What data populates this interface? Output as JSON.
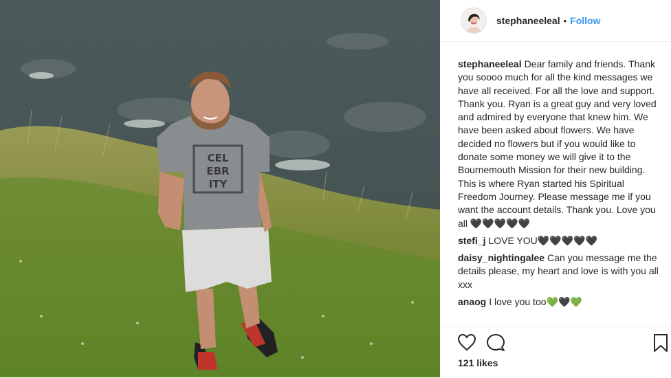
{
  "post": {
    "username": "stephaneeleal",
    "separator": "•",
    "follow_label": "Follow",
    "caption_user": "stephaneeleal",
    "caption_text": "Dear family and friends. Thank you soooo much for all the kind messages we have all received. For all the love and support. Thank you. Ryan is a great guy and very loved and admired by everyone that knew him. We have been asked about flowers. We have decided no flowers but if you would like to donate some money we will give it to the Bournemouth Mission for their new building. This is where Ryan started his Spiritual Freedom Journey. Please message me if you want the account details. Thank you. Love you all 🖤🖤🖤🖤🖤",
    "likes": "121 likes"
  },
  "photo": {
    "shirt_text_1": "CEL",
    "shirt_text_2": "EBR",
    "shirt_text_3": "ITY"
  },
  "comments": [
    {
      "user": "stefi_j",
      "text": "LOVE YOU🖤🖤🖤🖤🖤"
    },
    {
      "user": "daisy_nightingalee",
      "text": "Can you message me the details please, my heart and love is with you all xxx"
    },
    {
      "user": "anaog",
      "text": "I love you too💚🖤💚"
    }
  ],
  "icons": {
    "like": "heart-icon",
    "comment": "comment-icon",
    "save": "bookmark-icon"
  },
  "colors": {
    "follow": "#3897f0",
    "text": "#262626",
    "divider": "#efefef"
  }
}
